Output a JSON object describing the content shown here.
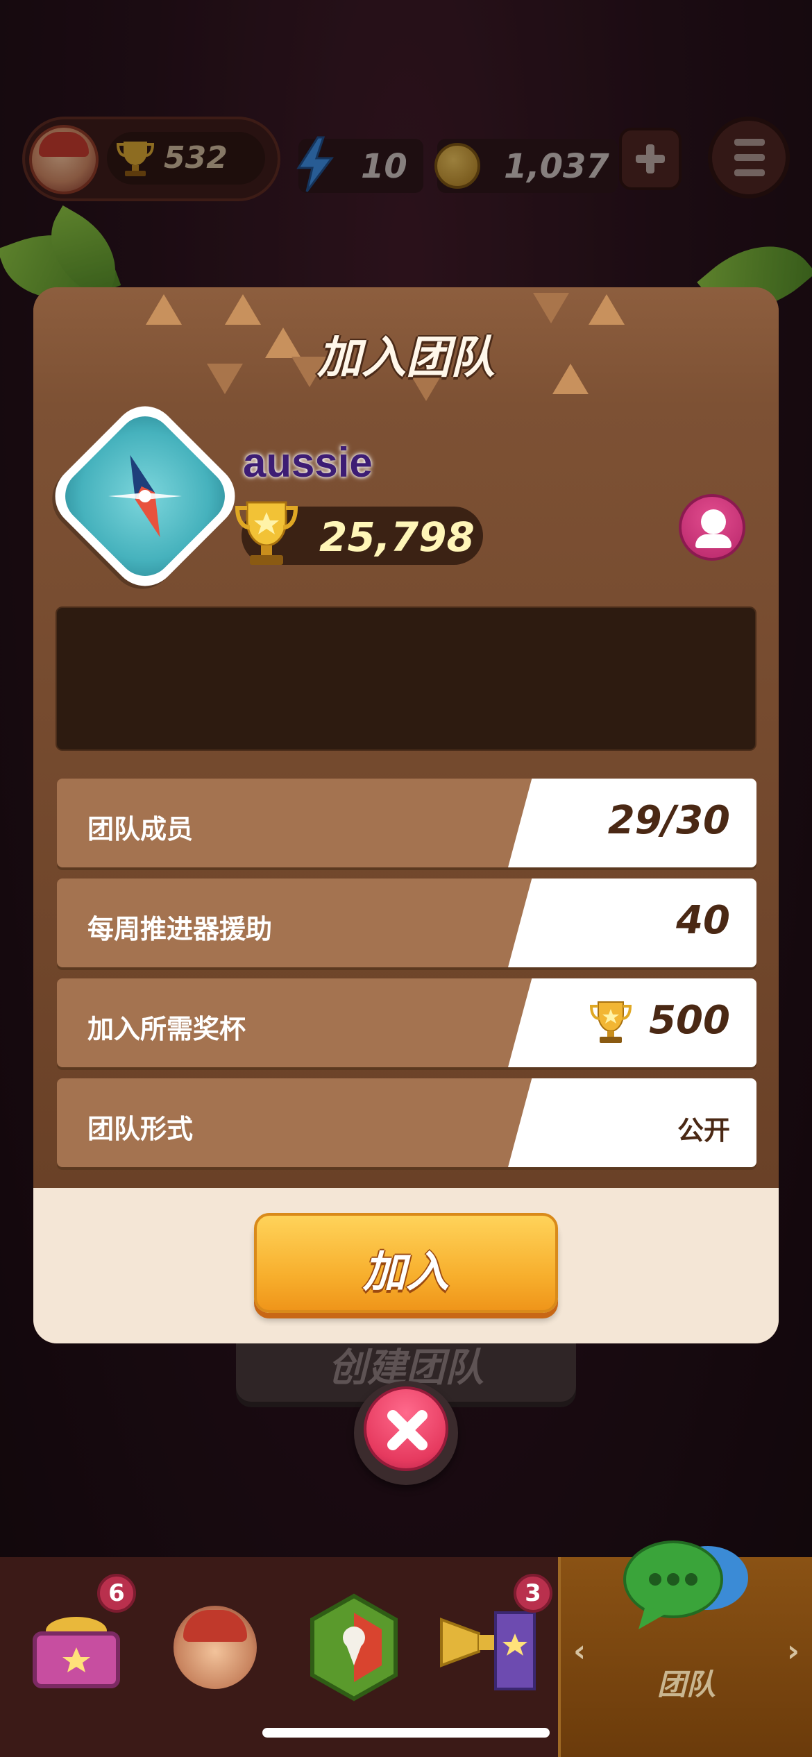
{
  "topbar": {
    "trophies": "532",
    "energy": "10",
    "coins": "1,037"
  },
  "dialog": {
    "title": "加入团队",
    "team_name": "aussie",
    "team_trophies": "25,798",
    "description": "",
    "rows": [
      {
        "label": "团队成员",
        "value": "29/30"
      },
      {
        "label": "每周推进器援助",
        "value": "40"
      },
      {
        "label": "加入所需奖杯",
        "value": "500"
      },
      {
        "label": "团队形式",
        "value": "公开"
      }
    ],
    "join_label": "加入"
  },
  "background": {
    "create_team_label": "创建团队"
  },
  "bottom_nav": {
    "shop_badge": "6",
    "events_badge": "3",
    "team_label": "团队"
  },
  "colors": {
    "dialog_brown": "#7d5134",
    "row_brown": "#a47350",
    "join_orange": "#f7ae2c",
    "close_pink": "#e63a5f",
    "team_name_purple": "#3a2270"
  }
}
